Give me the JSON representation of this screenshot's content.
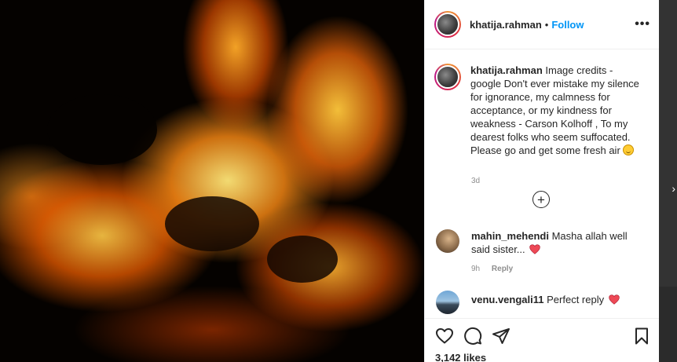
{
  "post": {
    "username": "khatija.rahman",
    "separator": "•",
    "follow_label": "Follow",
    "more_label": "•••"
  },
  "caption": {
    "username": "khatija.rahman",
    "text": "Image credits - google Don't ever mistake my silence for ignorance, my calmness for acceptance, or my kindness for weakness - Carson Kolhoff , To my dearest folks who seem suffocated. Please go and get some fresh air",
    "emoji": "smiling-face",
    "time": "3d"
  },
  "load_more_label": "+",
  "comments": [
    {
      "username": "mahin_mehendi",
      "text": "Masha allah well said sister...",
      "emoji": "red-heart",
      "time": "9h",
      "reply_label": "Reply"
    },
    {
      "username": "venu.vengali11",
      "text": "Perfect reply",
      "emoji": "red-heart"
    }
  ],
  "likes": "3,142 likes",
  "icons": {
    "like": "heart-outline-icon",
    "comment": "comment-bubble-icon",
    "share": "paper-plane-icon",
    "save": "bookmark-icon"
  },
  "colors": {
    "link": "#0095f6",
    "text": "#262626",
    "muted": "#8e8e8e",
    "heart": "#ed4956"
  }
}
